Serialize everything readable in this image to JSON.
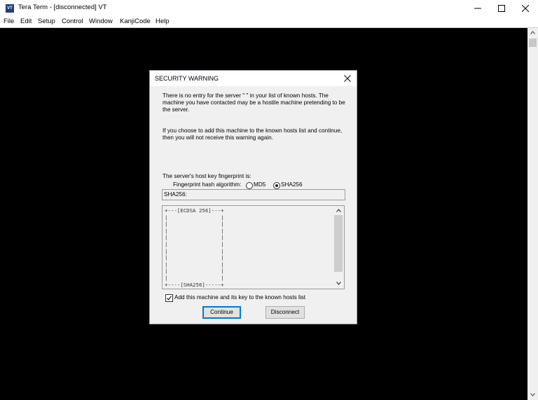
{
  "window": {
    "title": "Tera Term - [disconnected] VT",
    "app_icon_text": "VT"
  },
  "menubar": {
    "items": [
      "File",
      "Edit",
      "Setup",
      "Control",
      "Window",
      "KanjiCode",
      "Help"
    ]
  },
  "dialog": {
    "title": "SECURITY WARNING",
    "warning_text": "There is no entry for the server \"                      \" in your list of known hosts. The machine you have contacted may be a hostile machine pretending to be the server.",
    "add_info_text": "If you choose to add this machine to the known hosts list and continue, then you will not receive this warning again.",
    "fingerprint_label": "The server's host key fingerprint is:",
    "hash_algorithm_label": "Fingerprint hash algorithm:",
    "hash_options": [
      {
        "label": "MD5",
        "selected": false
      },
      {
        "label": "SHA256",
        "selected": true
      }
    ],
    "fingerprint_value": "SHA256:",
    "randomart": "+---[ECDSA 256]---+\n|                 |\n|                 |\n|                 |\n|                 |\n|                 |\n|                 |\n|                 |\n|                 |\n|                 |\n|                 |\n+----[SHA256]-----+",
    "add_checkbox_label": "Add this machine and its key to the known hosts list",
    "add_checkbox_checked": true,
    "continue_label": "Continue",
    "disconnect_label": "Disconnect"
  },
  "colors": {
    "terminal_bg": "#000000",
    "dialog_bg": "#f0f0f0",
    "default_button_border": "#0078d7"
  }
}
